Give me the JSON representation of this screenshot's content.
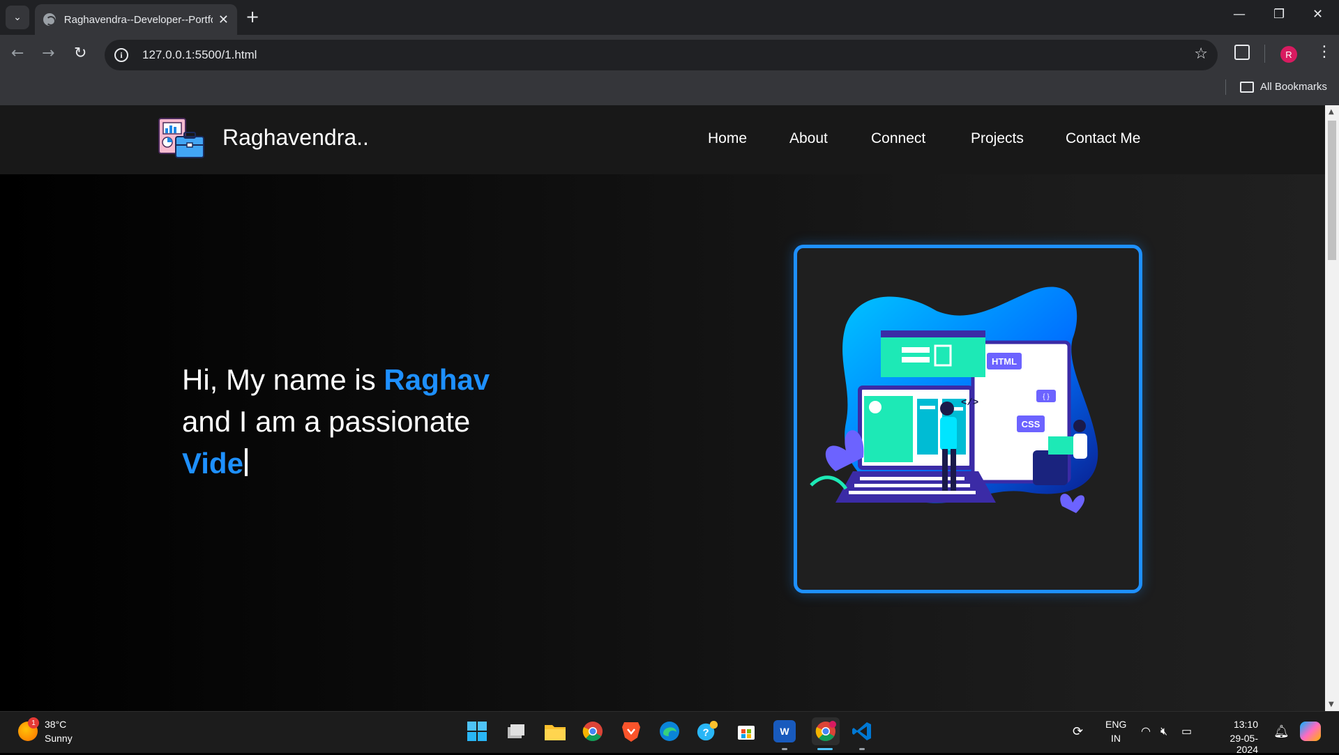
{
  "browser": {
    "tab_title": "Raghavendra--Developer--Portfolio",
    "url": "127.0.0.1:5500/1.html",
    "bookmarks_label": "All Bookmarks",
    "profile_initial": "R"
  },
  "site": {
    "brand": "Raghavendra..",
    "nav": [
      "Home",
      "About",
      "Connect",
      "Projects",
      "Contact Me"
    ],
    "hero": {
      "line1_prefix": "Hi, My name is ",
      "line1_name": "Raghav",
      "line2": "and I am a passionate",
      "line3_typed": "Vide"
    },
    "illustration": {
      "html_tag": "HTML",
      "css_tag": "CSS",
      "braces_tag": "{ }",
      "code_tag": "</>"
    },
    "accent_color": "#1e90ff"
  },
  "taskbar": {
    "weather_temp": "38°C",
    "weather_desc": "Sunny",
    "weather_badge": "1",
    "lang_top": "ENG",
    "lang_bottom": "IN",
    "time": "13:10",
    "date": "29-05-2024",
    "apps": [
      "windows-start",
      "task-view",
      "file-explorer",
      "chrome",
      "brave",
      "edge",
      "help",
      "microsoft-store",
      "word",
      "chrome-profile",
      "vscode"
    ]
  }
}
